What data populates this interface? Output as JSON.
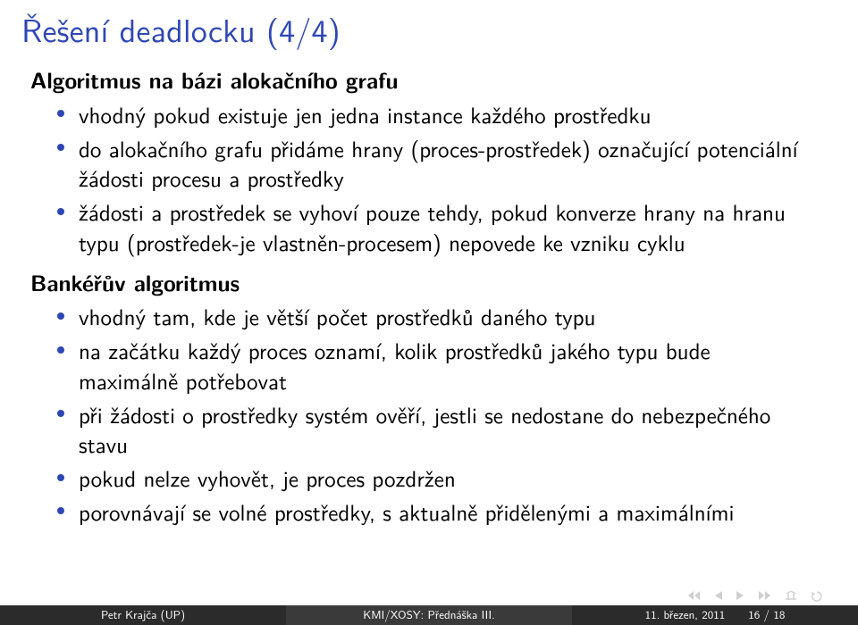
{
  "title": "Řešení deadlocku (4/4)",
  "section1": {
    "heading": "Algoritmus na bázi alokačního grafu",
    "bullets": [
      "vhodný pokud existuje jen jedna instance každého prostředku",
      "do alokačního grafu přidáme hrany (proces-prostředek) označující potenciální žádosti procesu a prostředky",
      "žádosti a prostředek se vyhoví pouze tehdy, pokud konverze hrany na hranu typu (prostředek-je vlastněn-procesem) nepovede ke vzniku cyklu"
    ]
  },
  "section2": {
    "heading": "Bankéřův algoritmus",
    "bullets": [
      "vhodný tam, kde je větší počet prostředků daného typu",
      "na začátku každý proces oznamí, kolik prostředků jakého typu bude maximálně potřebovat",
      "při žádosti o prostředky systém ověří, jestli se nedostane do nebezpečného stavu",
      "pokud nelze vyhovět, je proces pozdržen",
      "porovnávají se volné prostředky, s aktualně přidělenými a maximálními"
    ]
  },
  "footer": {
    "author": "Petr Krajča (UP)",
    "course": "KMI/XOSY: Přednáška III.",
    "date": "11. březen, 2011",
    "page": "16 / 18"
  },
  "nav_icons": [
    "nav-first",
    "nav-prev",
    "nav-next",
    "nav-last",
    "nav-up",
    "nav-loop"
  ]
}
